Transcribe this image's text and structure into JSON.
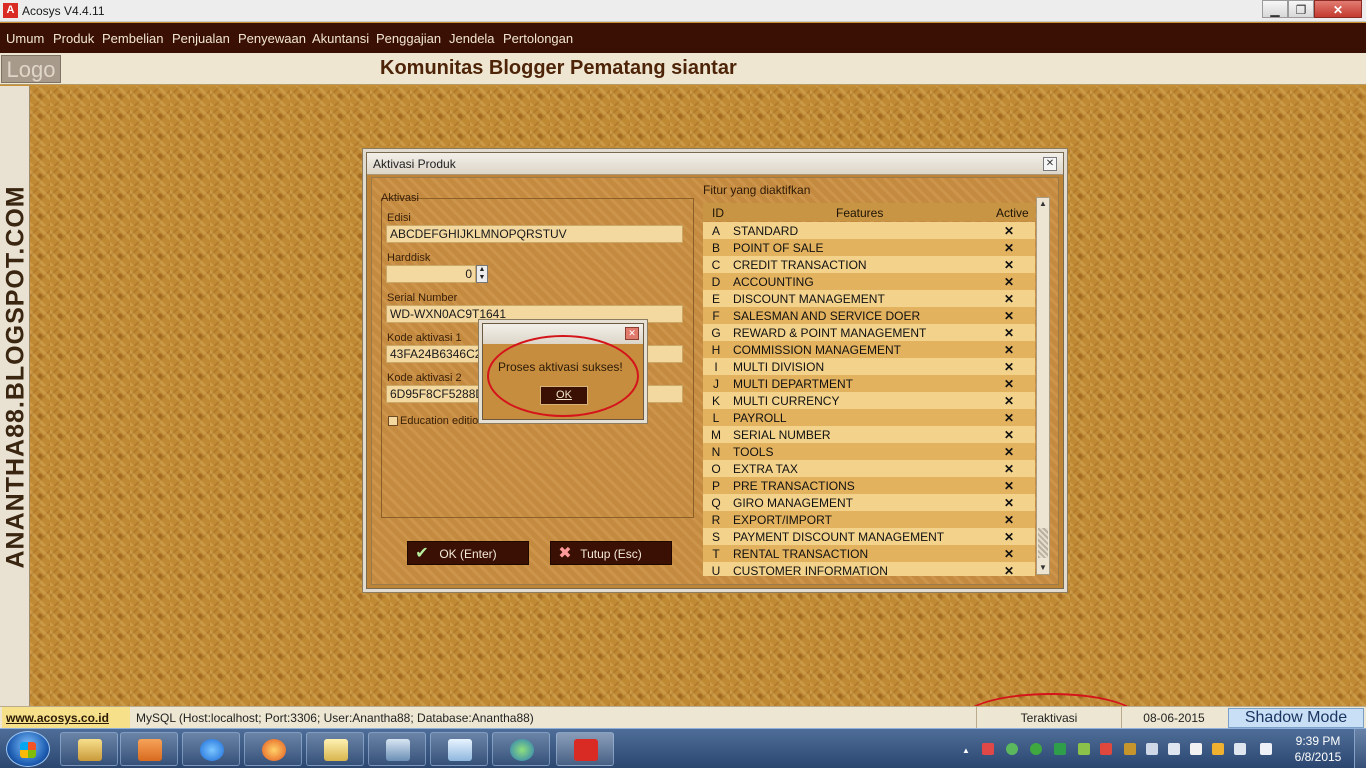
{
  "window": {
    "title": "Acosys V4.4.11",
    "icon": "acosys-app-icon"
  },
  "menu": [
    "Umum",
    "Produk",
    "Pembelian",
    "Penjualan",
    "Penyewaan",
    "Akuntansi",
    "Penggajian",
    "Jendela",
    "Pertolongan"
  ],
  "header": {
    "logo_text": "Logo",
    "company": "Komunitas Blogger Pematang siantar"
  },
  "sidebar": {
    "watermark": "ANANTHA88.BLOGSPOT.COM"
  },
  "dialog": {
    "title": "Aktivasi Produk",
    "aktivasi_group": "Aktivasi",
    "edisi_label": "Edisi",
    "edisi_value": "ABCDEFGHIJKLMNOPQRSTUV",
    "harddisk_label": "Harddisk",
    "harddisk_value": "0",
    "serial_label": "Serial Number",
    "serial_value": "WD-WXN0AC9T1641",
    "kode1_label": "Kode aktivasi 1",
    "kode1_value": "43FA24B6346C2",
    "kode2_label": "Kode aktivasi 2",
    "kode2_value": "6D95F8CF5288D",
    "education_label": "Education edition",
    "ok_label": "OK (Enter)",
    "close_label": "Tutup (Esc)",
    "features_title": "Fitur yang diaktifkan",
    "columns": [
      "ID",
      "Features",
      "Active"
    ],
    "features": [
      [
        "A",
        "STANDARD",
        "✕"
      ],
      [
        "B",
        "POINT OF SALE",
        "✕"
      ],
      [
        "C",
        "CREDIT TRANSACTION",
        "✕"
      ],
      [
        "D",
        "ACCOUNTING",
        "✕"
      ],
      [
        "E",
        "DISCOUNT MANAGEMENT",
        "✕"
      ],
      [
        "F",
        "SALESMAN AND SERVICE DOER",
        "✕"
      ],
      [
        "G",
        "REWARD & POINT MANAGEMENT",
        "✕"
      ],
      [
        "H",
        "COMMISSION MANAGEMENT",
        "✕"
      ],
      [
        "I",
        "MULTI DIVISION",
        "✕"
      ],
      [
        "J",
        "MULTI DEPARTMENT",
        "✕"
      ],
      [
        "K",
        "MULTI CURRENCY",
        "✕"
      ],
      [
        "L",
        "PAYROLL",
        "✕"
      ],
      [
        "M",
        "SERIAL NUMBER",
        "✕"
      ],
      [
        "N",
        "TOOLS",
        "✕"
      ],
      [
        "O",
        "EXTRA TAX",
        "✕"
      ],
      [
        "P",
        "PRE TRANSACTIONS",
        "✕"
      ],
      [
        "Q",
        "GIRO MANAGEMENT",
        "✕"
      ],
      [
        "R",
        "EXPORT/IMPORT",
        "✕"
      ],
      [
        "S",
        "PAYMENT DISCOUNT MANAGEMENT",
        "✕"
      ],
      [
        "T",
        "RENTAL TRANSACTION",
        "✕"
      ],
      [
        "U",
        "CUSTOMER INFORMATION",
        "✕"
      ]
    ]
  },
  "message": {
    "text": "Proses aktivasi sukses!",
    "ok": "OK"
  },
  "status": {
    "website": "www.acosys.co.id",
    "database": "MySQL (Host:localhost; Port:3306; User:Anantha88; Database:Anantha88)",
    "activation": "Teraktivasi",
    "date": "08-06-2015",
    "mode": "Shadow Mode"
  },
  "taskbar": {
    "apps": [
      "explorer-icon",
      "media-player-icon",
      "internet-explorer-icon",
      "firefox-icon",
      "notepad-icon",
      "remote-desktop-icon",
      "windows-mail-icon",
      "globe-icon",
      "acosys-app-icon"
    ],
    "time": "9:39 PM",
    "date": "6/8/2015"
  },
  "colors": {
    "accent_dark": "#3a1004",
    "annotation_red": "#d4141a"
  }
}
